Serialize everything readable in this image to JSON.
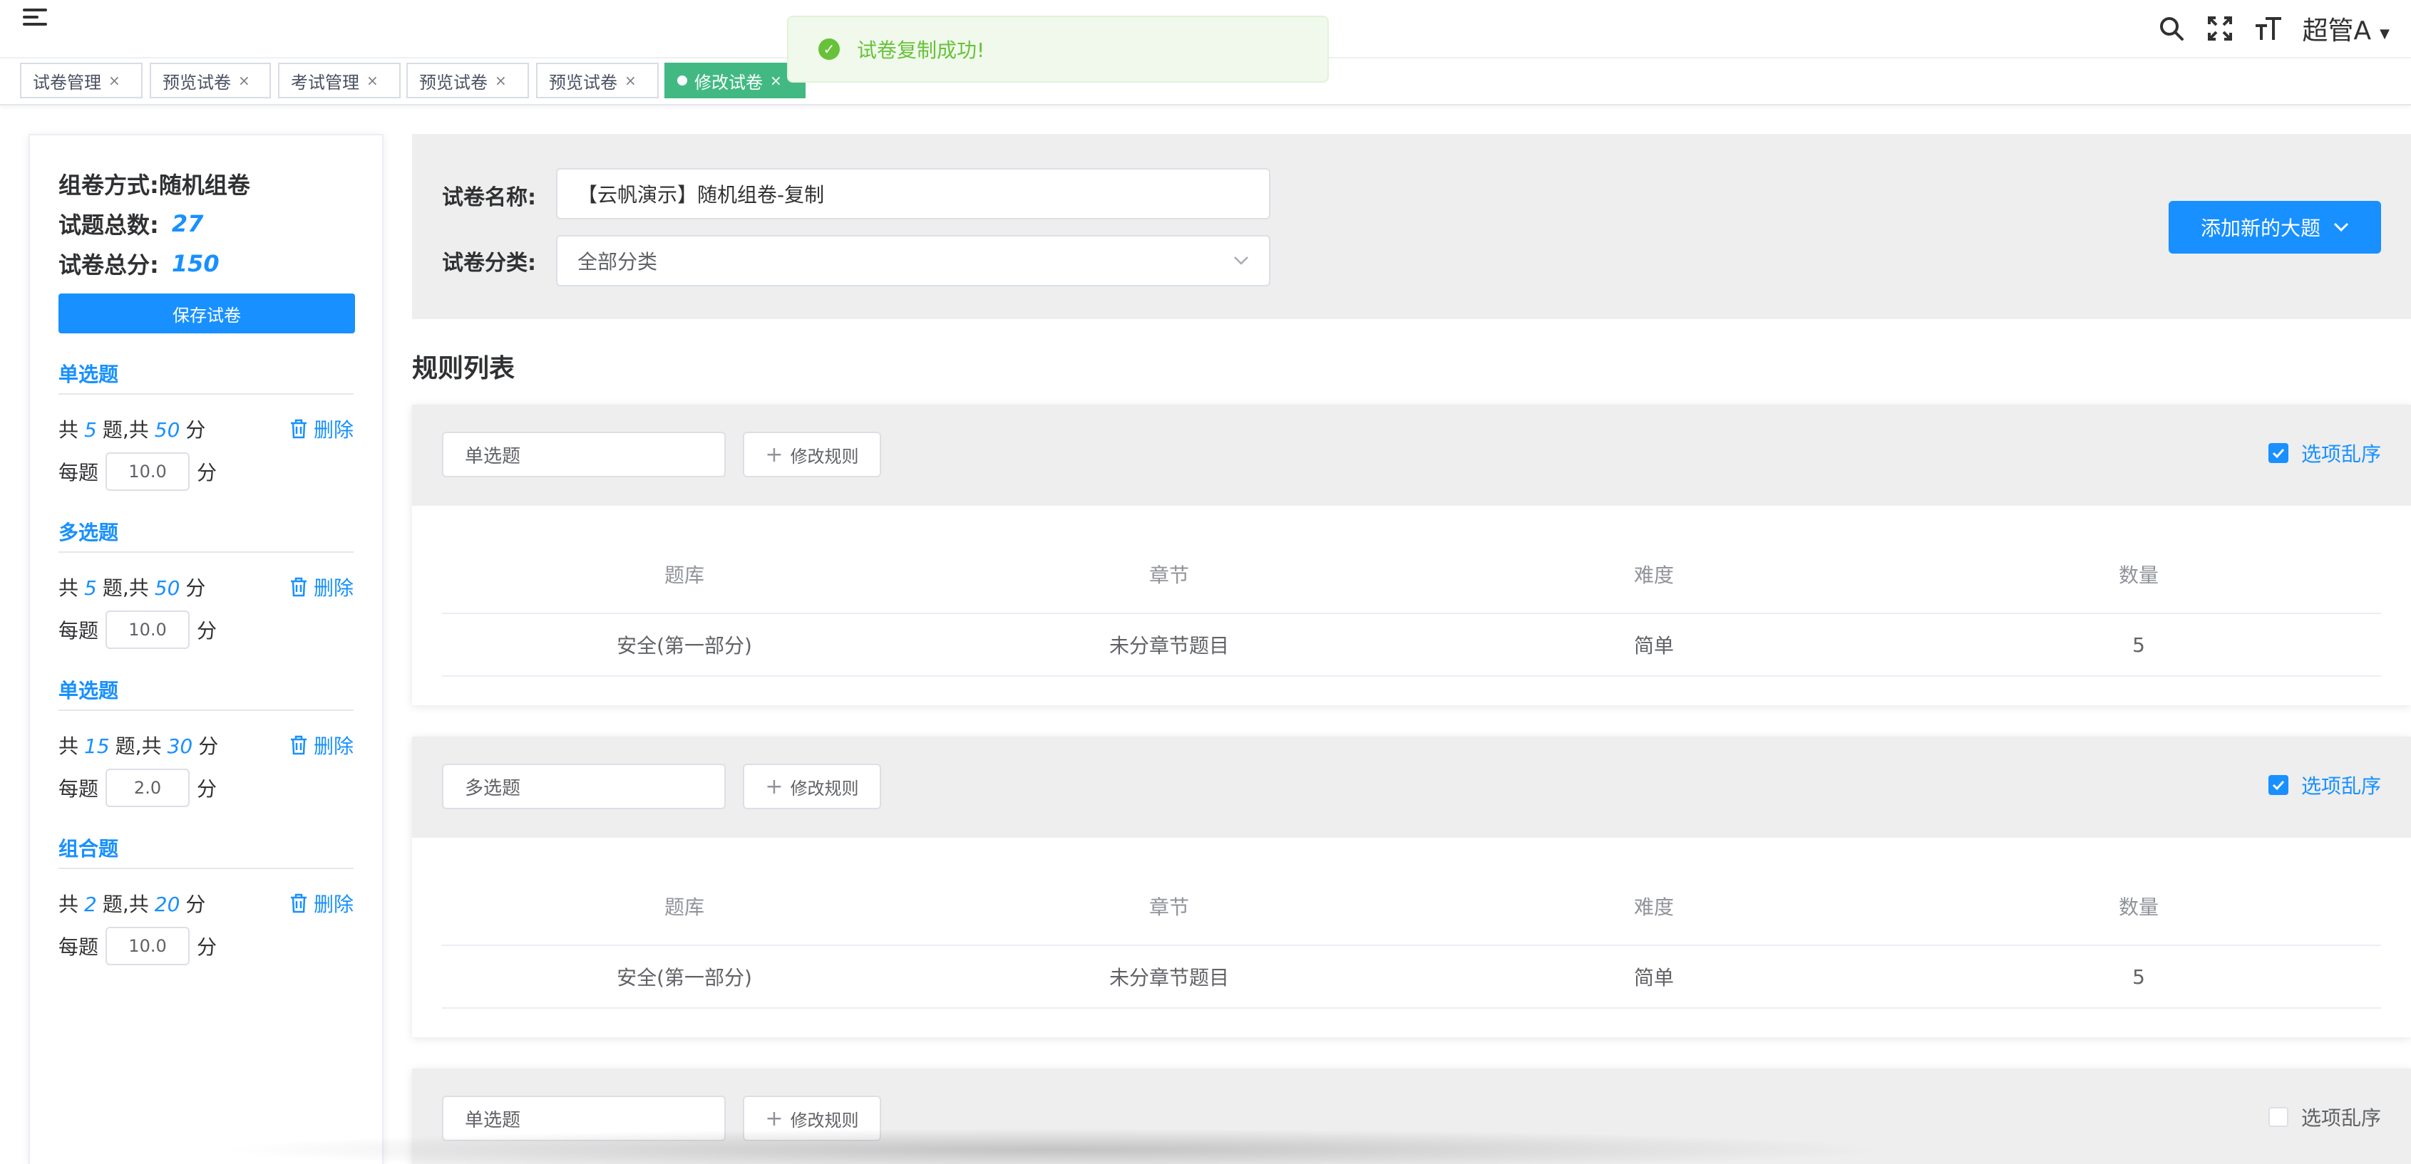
{
  "header": {
    "user_name": "超管A"
  },
  "tabs": [
    {
      "label": "试卷管理",
      "active": false
    },
    {
      "label": "预览试卷",
      "active": false
    },
    {
      "label": "考试管理",
      "active": false
    },
    {
      "label": "预览试卷",
      "active": false
    },
    {
      "label": "预览试卷",
      "active": false
    },
    {
      "label": "修改试卷",
      "active": true
    }
  ],
  "tab_close": "×",
  "toast": {
    "message": "试卷复制成功!"
  },
  "summary": {
    "mode_label": "组卷方式:",
    "mode_value": "随机组卷",
    "total_label": "试题总数:",
    "total_value": "27",
    "score_label": "试卷总分:",
    "score_value": "150",
    "save_button": "保存试卷"
  },
  "groups": [
    {
      "title": "单选题",
      "count": "5",
      "score": "50",
      "per": "10.0"
    },
    {
      "title": "多选题",
      "count": "5",
      "score": "50",
      "per": "10.0"
    },
    {
      "title": "单选题",
      "count": "15",
      "score": "30",
      "per": "2.0"
    },
    {
      "title": "组合题",
      "count": "2",
      "score": "20",
      "per": "10.0"
    }
  ],
  "group_text": {
    "gong": "共",
    "ti": "题,",
    "gong2": "共",
    "fen": "分",
    "per_label": "每题",
    "per_unit": "分",
    "delete": "删除"
  },
  "form": {
    "name_label": "试卷名称:",
    "name_value": "【云帆演示】随机组卷-复制",
    "category_label": "试卷分类:",
    "category_value": "全部分类",
    "add_button": "添加新的大题"
  },
  "rules_title": "规则列表",
  "rule_text": {
    "edit_button": "修改规则",
    "shuffle_label": "选项乱序",
    "columns": [
      "题库",
      "章节",
      "难度",
      "数量"
    ]
  },
  "rules": [
    {
      "type": "单选题",
      "shuffle": true,
      "rows": [
        [
          "安全(第一部分)",
          "未分章节题目",
          "简单",
          "5"
        ]
      ]
    },
    {
      "type": "多选题",
      "shuffle": true,
      "rows": [
        [
          "安全(第一部分)",
          "未分章节题目",
          "简单",
          "5"
        ]
      ]
    },
    {
      "type": "单选题",
      "shuffle": false,
      "rows": []
    }
  ],
  "colors": {
    "primary": "#1890ff",
    "tab_active": "#42b983",
    "success": "#67c23a"
  }
}
